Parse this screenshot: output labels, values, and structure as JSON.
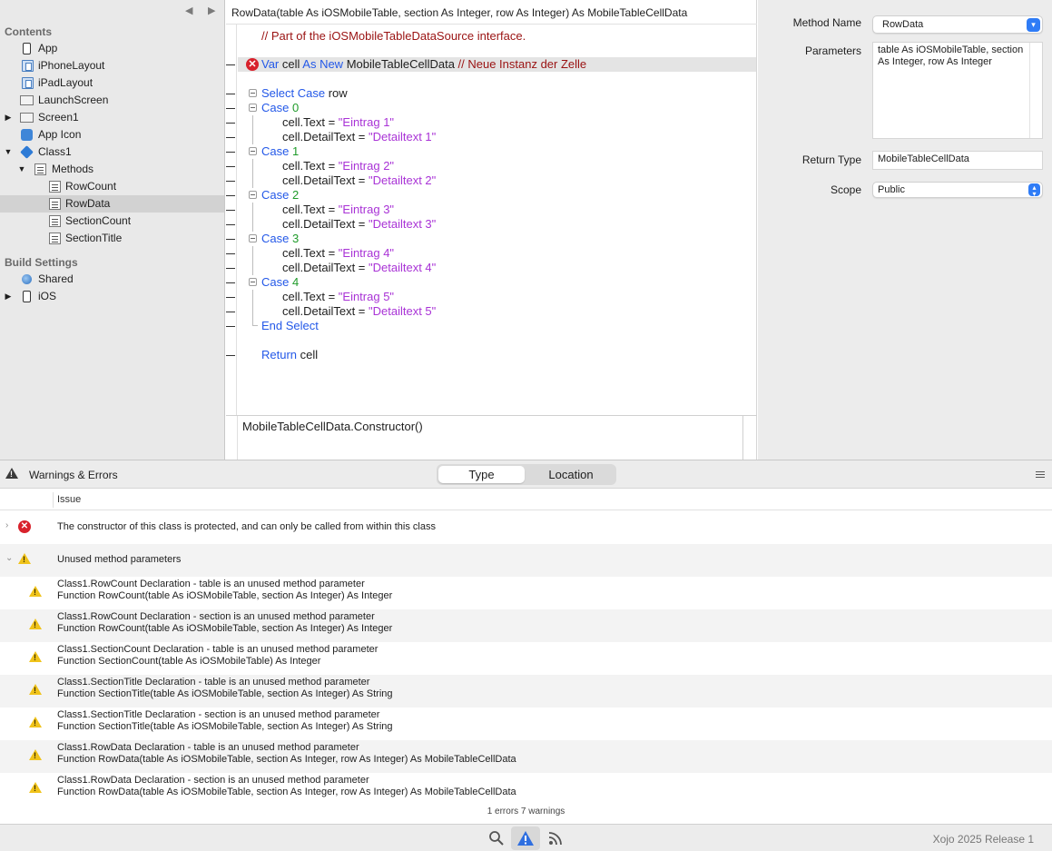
{
  "navigator": {
    "back_icon": "triangle-left-icon",
    "forward_icon": "triangle-right-icon",
    "contents_label": "Contents",
    "build_settings_label": "Build Settings",
    "items": [
      {
        "label": "App",
        "icon": "phone-icon",
        "disclosure": ""
      },
      {
        "label": "iPhoneLayout",
        "icon": "layout-icon",
        "disclosure": ""
      },
      {
        "label": "iPadLayout",
        "icon": "layout-icon",
        "disclosure": ""
      },
      {
        "label": "LaunchScreen",
        "icon": "screen-icon",
        "disclosure": ""
      },
      {
        "label": "Screen1",
        "icon": "screen-icon",
        "disclosure": "▶"
      },
      {
        "label": "App Icon",
        "icon": "app-icon-icon",
        "disclosure": ""
      },
      {
        "label": "Class1",
        "icon": "class-icon",
        "disclosure": "▼"
      },
      {
        "label": "Methods",
        "icon": "folder-icon",
        "disclosure": "▼"
      },
      {
        "label": "RowCount",
        "icon": "method-icon",
        "disclosure": ""
      },
      {
        "label": "RowData",
        "icon": "method-icon",
        "disclosure": "",
        "selected": true
      },
      {
        "label": "SectionCount",
        "icon": "method-icon",
        "disclosure": ""
      },
      {
        "label": "SectionTitle",
        "icon": "method-icon",
        "disclosure": ""
      }
    ],
    "build_items": [
      {
        "label": "Shared",
        "icon": "shared-icon",
        "disclosure": ""
      },
      {
        "label": "iOS",
        "icon": "phone-icon",
        "disclosure": "▶"
      }
    ]
  },
  "editor": {
    "signature": "RowData(table As iOSMobileTable, section As Integer, row As Integer) As MobileTableCellData",
    "autocomplete": "MobileTableCellData.Constructor()"
  },
  "code": {
    "l1": {
      "c": "// Part of the iOSMobileTableDataSource interface."
    },
    "l2": {
      "k1": "Var",
      "t1": " cell ",
      "k2": "As New",
      "t2": " MobileTableCellData  ",
      "c": "// Neue Instanz der Zelle"
    },
    "l3": {
      "k": "Select Case",
      "t": " row"
    },
    "c0": {
      "k": "Case",
      "n": " 0",
      "s1": "\"Eintrag 1\"",
      "s2": "\"Detailtext 1\""
    },
    "c1": {
      "k": "Case",
      "n": " 1",
      "s1": "\"Eintrag 2\"",
      "s2": "\"Detailtext 2\""
    },
    "c2": {
      "k": "Case",
      "n": " 2",
      "s1": "\"Eintrag 3\"",
      "s2": "\"Detailtext 3\""
    },
    "c3": {
      "k": "Case",
      "n": " 3",
      "s1": "\"Eintrag 4\"",
      "s2": "\"Detailtext 4\""
    },
    "c4": {
      "k": "Case",
      "n": " 4",
      "s1": "\"Eintrag 5\"",
      "s2": "\"Detailtext 5\""
    },
    "text_lhs": "cell.Text = ",
    "detail_lhs": "cell.DetailText = ",
    "end_select": "End Select",
    "ret": {
      "k": "Return",
      "t": " cell"
    }
  },
  "inspector": {
    "method_name_label": "Method Name",
    "method_name_value": "RowData",
    "parameters_label": "Parameters",
    "parameters_value": "table As iOSMobileTable, section As Integer, row As Integer",
    "return_type_label": "Return Type",
    "return_type_value": "MobileTableCellData",
    "scope_label": "Scope",
    "scope_value": "Public"
  },
  "issues": {
    "title": "Warnings & Errors",
    "tab_type": "Type",
    "tab_location": "Location",
    "column_issue": "Issue",
    "error_row": "The constructor of this class is protected, and can only be called from within this class",
    "warning_group": "Unused method parameters",
    "warnings": [
      {
        "line1": "Class1.RowCount Declaration - table is an unused method parameter",
        "line2": "Function RowCount(table As iOSMobileTable, section As Integer) As Integer"
      },
      {
        "line1": "Class1.RowCount Declaration - section is an unused method parameter",
        "line2": "Function RowCount(table As iOSMobileTable, section As Integer) As Integer"
      },
      {
        "line1": "Class1.SectionCount Declaration - table is an unused method parameter",
        "line2": "Function SectionCount(table As iOSMobileTable) As Integer"
      },
      {
        "line1": "Class1.SectionTitle Declaration - table is an unused method parameter",
        "line2": "Function SectionTitle(table As iOSMobileTable, section As Integer) As String"
      },
      {
        "line1": "Class1.SectionTitle Declaration - section is an unused method parameter",
        "line2": "Function SectionTitle(table As iOSMobileTable, section As Integer) As String"
      },
      {
        "line1": "Class1.RowData Declaration - table is an unused method parameter",
        "line2": "Function RowData(table As iOSMobileTable, section As Integer, row As Integer) As MobileTableCellData"
      },
      {
        "line1": "Class1.RowData Declaration - section is an unused method parameter",
        "line2": "Function RowData(table As iOSMobileTable, section As Integer, row As Integer) As MobileTableCellData"
      }
    ],
    "summary": "1 errors 7 warnings"
  },
  "statusbar": {
    "version": "Xojo 2025 Release 1"
  },
  "colors": {
    "keyword": "#2358e8",
    "string": "#a933d6",
    "number": "#1f9b2a",
    "comment": "#9a1212",
    "error": "#d8222c",
    "warning": "#f0c31a",
    "accent": "#2f7cf6"
  }
}
